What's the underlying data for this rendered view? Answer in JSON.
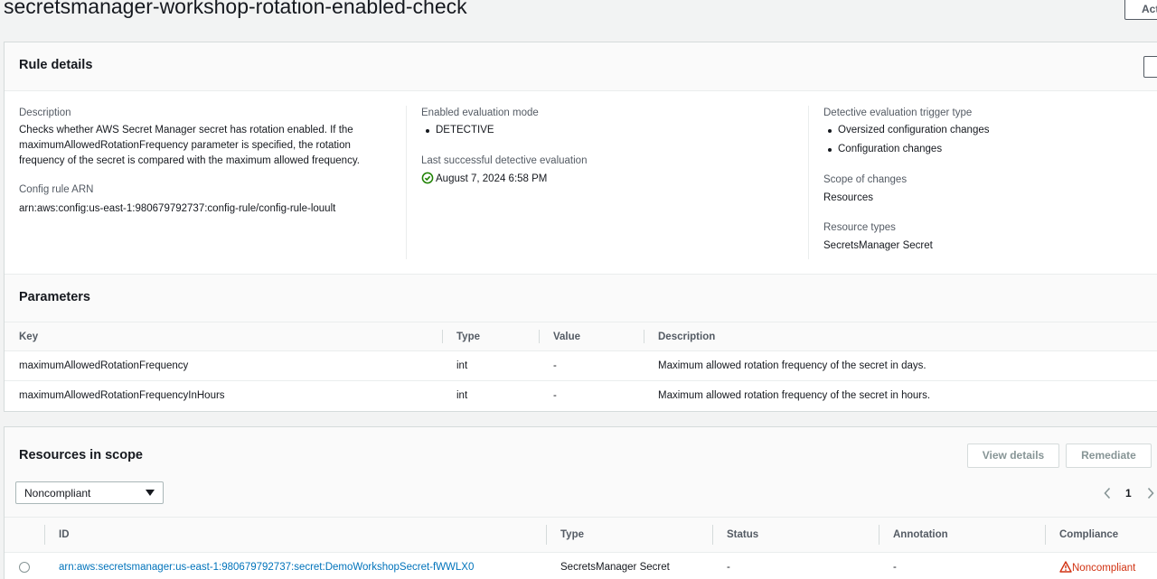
{
  "page": {
    "title": "secretsmanager-workshop-rotation-enabled-check",
    "actions_label": "Actions"
  },
  "rule_details": {
    "heading": "Rule details",
    "description_label": "Description",
    "description": "Checks whether AWS Secret Manager secret has rotation enabled. If the maximumAllowedRotationFrequency parameter is specified, the rotation frequency of the secret is compared with the maximum allowed frequency.",
    "arn_label": "Config rule ARN",
    "arn": "arn:aws:config:us-east-1:980679792737:config-rule/config-rule-louult",
    "eval_mode_label": "Enabled evaluation mode",
    "eval_modes": [
      "DETECTIVE"
    ],
    "last_eval_label": "Last successful detective evaluation",
    "last_eval": "August 7, 2024 6:58 PM",
    "trigger_label": "Detective evaluation trigger type",
    "triggers": [
      "Oversized configuration changes",
      "Configuration changes"
    ],
    "scope_label": "Scope of changes",
    "scope": "Resources",
    "resource_types_label": "Resource types",
    "resource_types": "SecretsManager Secret"
  },
  "parameters": {
    "heading": "Parameters",
    "columns": [
      "Key",
      "Type",
      "Value",
      "Description"
    ],
    "rows": [
      {
        "key": "maximumAllowedRotationFrequency",
        "type": "int",
        "value": "-",
        "description": "Maximum allowed rotation frequency of the secret in days."
      },
      {
        "key": "maximumAllowedRotationFrequencyInHours",
        "type": "int",
        "value": "-",
        "description": "Maximum allowed rotation frequency of the secret in hours."
      }
    ]
  },
  "resources": {
    "heading": "Resources in scope",
    "view_details_label": "View details",
    "remediate_label": "Remediate",
    "filter_value": "Noncompliant",
    "page_number": "1",
    "columns": [
      "ID",
      "Type",
      "Status",
      "Annotation",
      "Compliance"
    ],
    "rows": [
      {
        "id": "arn:aws:secretsmanager:us-east-1:980679792737:secret:DemoWorkshopSecret-fWWLX0",
        "type": "SecretsManager Secret",
        "status": "-",
        "annotation": "-",
        "compliance": "Noncompliant"
      }
    ]
  },
  "colors": {
    "link": "#0073bb",
    "success": "#1d8102",
    "error": "#d13212"
  }
}
